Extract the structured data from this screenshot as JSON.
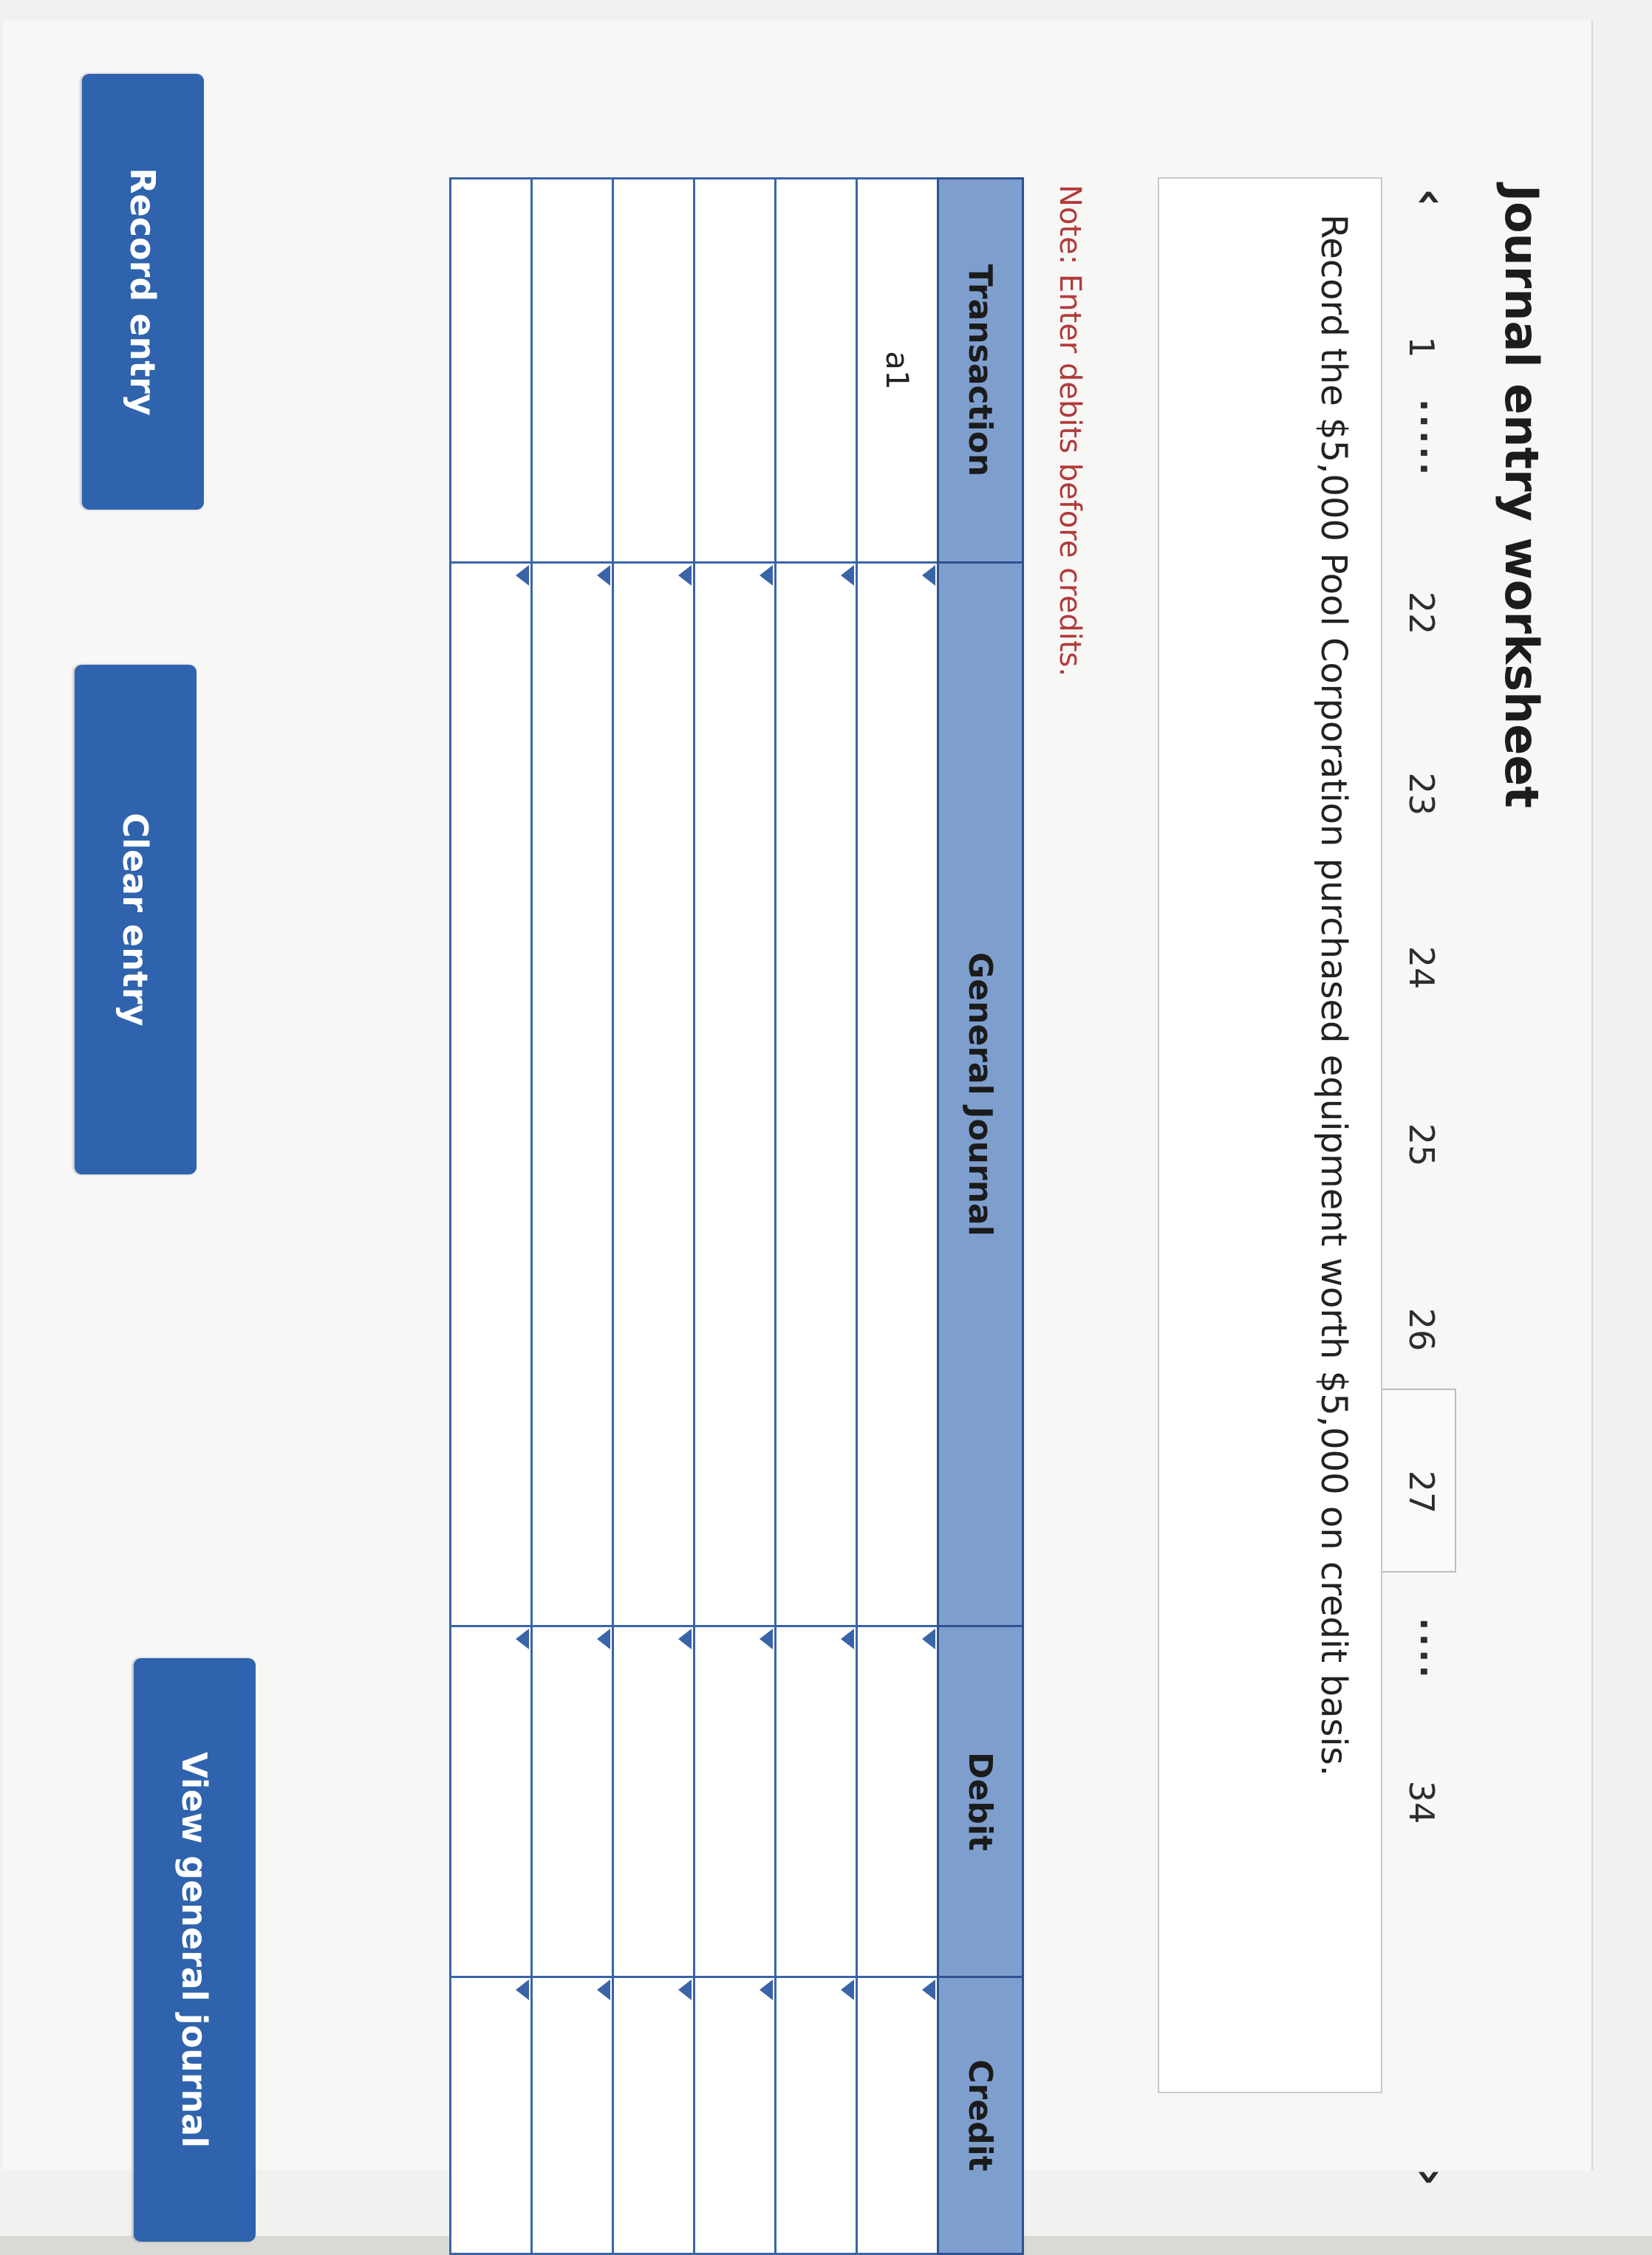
{
  "page": {
    "title": "Journal entry worksheet"
  },
  "pagination": {
    "prev_icon": "chevron-left-icon",
    "next_icon": "chevron-right-icon",
    "items": [
      {
        "label": "1"
      },
      {
        "label": "....."
      },
      {
        "label": "22"
      },
      {
        "label": "23"
      },
      {
        "label": "24"
      },
      {
        "label": "25"
      },
      {
        "label": "26"
      },
      {
        "label": "27"
      },
      {
        "label": "...."
      },
      {
        "label": "34"
      }
    ],
    "active": "27"
  },
  "question": {
    "text": "Record the $5,000 Pool Corporation purchased equipment worth $5,000 on credit basis."
  },
  "note": {
    "text": "Note: Enter debits before credits."
  },
  "journal": {
    "columns": {
      "transaction": "Transaction",
      "general_journal": "General Journal",
      "debit": "Debit",
      "credit": "Credit"
    },
    "rows": [
      {
        "transaction": "a1",
        "account": "",
        "debit": "",
        "credit": ""
      },
      {
        "transaction": "",
        "account": "",
        "debit": "",
        "credit": ""
      },
      {
        "transaction": "",
        "account": "",
        "debit": "",
        "credit": ""
      },
      {
        "transaction": "",
        "account": "",
        "debit": "",
        "credit": ""
      },
      {
        "transaction": "",
        "account": "",
        "debit": "",
        "credit": ""
      },
      {
        "transaction": "",
        "account": "",
        "debit": "",
        "credit": ""
      }
    ]
  },
  "buttons": {
    "record": "Record entry",
    "clear": "Clear entry",
    "view": "View general journal"
  },
  "colors": {
    "header_bg": "#7e9fce",
    "grid": "#3a64a8",
    "button": "#2f63ad",
    "note": "#b23a3a"
  }
}
